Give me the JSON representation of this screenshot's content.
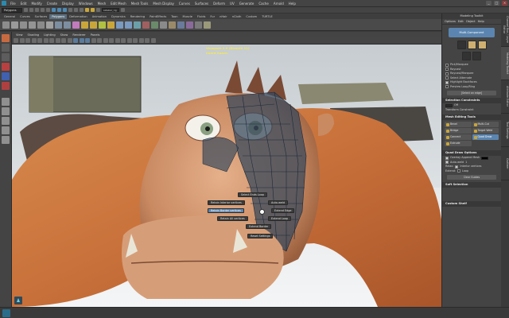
{
  "menubar": {
    "items": [
      "File",
      "Edit",
      "Modify",
      "Create",
      "Display",
      "Windows",
      "Mesh",
      "Edit Mesh",
      "Mesh Tools",
      "Mesh Display",
      "Curves",
      "Surfaces",
      "Deform",
      "UV",
      "Generate",
      "Cache",
      "Arnold",
      "Help"
    ],
    "window_controls": [
      "_",
      "□",
      "×"
    ]
  },
  "statusline": {
    "mode": "Polygons",
    "search_field": "sidebar_rig"
  },
  "shelf": {
    "tabs": [
      "General",
      "Curves",
      "Surfaces",
      "Polygons",
      "Deformation",
      "Animation",
      "Dynamics",
      "Rendering",
      "PaintEffects",
      "Toon",
      "Muscle",
      "Fluids",
      "Fur",
      "nHair",
      "nCloth",
      "Custom",
      "TURTLE"
    ],
    "active_tab": "Polygons"
  },
  "viewport": {
    "menu": [
      "View",
      "Shading",
      "Lighting",
      "Show",
      "Renderer",
      "Panels"
    ],
    "hud_line1": "Viewport 2.0 (DirectX 11)",
    "hud_line2": "Coord Space:"
  },
  "marking_menu": {
    "items": [
      {
        "label": "Select Ends Loop"
      },
      {
        "label": "Retain Interior vertices"
      },
      {
        "label": "Auto-weld"
      },
      {
        "label": "Retain Border vertices"
      },
      {
        "label": "Extend Edge"
      },
      {
        "label": "Retain All vertices"
      },
      {
        "label": "Extend Loop"
      },
      {
        "label": "Extend Border"
      },
      {
        "label": "Reset Settings"
      }
    ],
    "highlighted": "Retain Border vertices"
  },
  "right_panel": {
    "title": "Modeling Toolkit",
    "menu": [
      "Options",
      "Edit",
      "Object",
      "Help"
    ],
    "selection_mode": "Multi-Component",
    "options": [
      {
        "label": "Pick/Marquee",
        "on": false
      },
      {
        "label": "Raycast",
        "on": false
      },
      {
        "label": "Raycast/Marquee",
        "on": false
      },
      {
        "label": "Select Alternate",
        "on": false
      },
      {
        "label": "Highlight Backfaces",
        "on": true
      },
      {
        "label": "Preview Loop/Ring",
        "on": false
      }
    ],
    "select_edge_hint": "[Select an edge]",
    "constraints_header": "Selection Constraints",
    "constraint_value": "Off",
    "transform_constraints": "Transform Constraint",
    "mesh_editing_header": "Mesh Editing Tools",
    "tools": [
      {
        "label": "Bevel",
        "hl": false
      },
      {
        "label": "Multi-Cut",
        "hl": false
      },
      {
        "label": "Bridge",
        "hl": false
      },
      {
        "label": "Target Weld",
        "hl": false
      },
      {
        "label": "Connect",
        "hl": false
      },
      {
        "label": "Quad Draw",
        "hl": true
      },
      {
        "label": "Extrude",
        "hl": false
      }
    ],
    "quad_draw_header": "Quad Draw Options",
    "overlay_label": "Overlay Append Mesh",
    "auto_weld_label": "Auto-weld",
    "auto_weld_value": "1",
    "relax_label": "Relax:",
    "relax_value": "Interior vertices",
    "extend_label": "Extend:",
    "extend_value": "Loop",
    "clear_button": "Clear Guides",
    "soft_selection_header": "Soft Selection",
    "custom_shelf": "Custom Shelf"
  },
  "side_tabs": [
    "Channel Box / Layer Editor",
    "Modeling Toolkit",
    "Attribute Editor",
    "Tool Settings",
    "Outliner"
  ]
}
